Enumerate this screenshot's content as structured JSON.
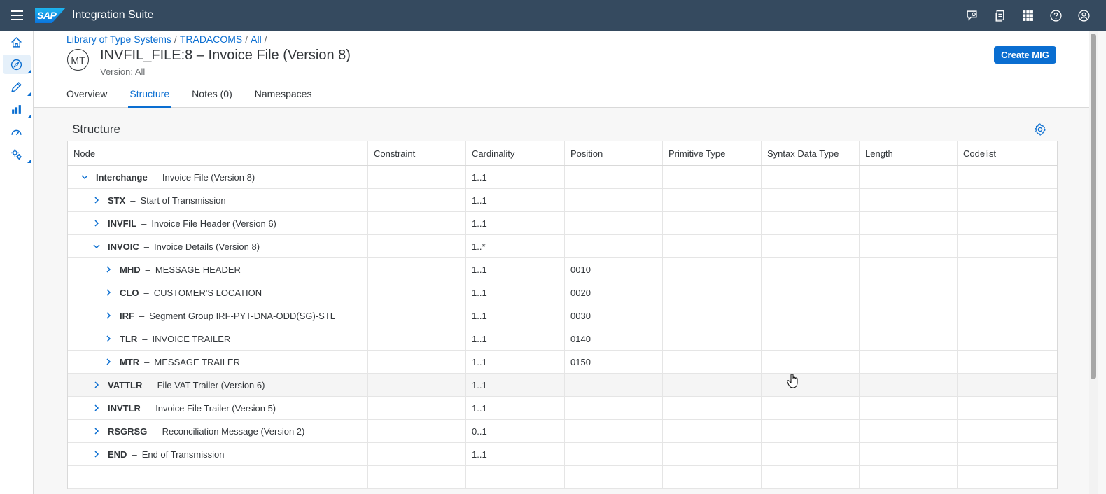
{
  "shell": {
    "product": "Integration Suite",
    "logo_text": "SAP",
    "actions": [
      "feedback-icon",
      "notes-icon",
      "grid-icon",
      "help-icon",
      "user-icon"
    ]
  },
  "sidenav": [
    "home-icon",
    "discover-icon",
    "design-icon",
    "monitor-icon",
    "dashboard-icon",
    "settings-icon"
  ],
  "breadcrumb": [
    "Library of Type Systems",
    "TRADACOMS",
    "All"
  ],
  "header": {
    "avatar": "MT",
    "title": "INVFIL_FILE:8 – Invoice File (Version 8)",
    "subtitle": "Version: All",
    "create_button": "Create MIG"
  },
  "tabs": [
    "Overview",
    "Structure",
    "Notes (0)",
    "Namespaces"
  ],
  "active_tab": "Structure",
  "section": {
    "title": "Structure"
  },
  "columns": [
    "Node",
    "Constraint",
    "Cardinality",
    "Position",
    "Primitive Type",
    "Syntax Data Type",
    "Length",
    "Codelist"
  ],
  "rows": [
    {
      "level": 0,
      "expanded": true,
      "name": "Interchange",
      "desc": "Invoice File (Version 8)",
      "constraint": "",
      "cardinality": "1..1",
      "position": ""
    },
    {
      "level": 1,
      "expanded": false,
      "name": "STX",
      "desc": "Start of Transmission",
      "constraint": "",
      "cardinality": "1..1",
      "position": ""
    },
    {
      "level": 1,
      "expanded": false,
      "name": "INVFIL",
      "desc": "Invoice File Header (Version 6)",
      "constraint": "",
      "cardinality": "1..1",
      "position": ""
    },
    {
      "level": 1,
      "expanded": true,
      "name": "INVOIC",
      "desc": "Invoice Details (Version 8)",
      "constraint": "",
      "cardinality": "1..*",
      "position": ""
    },
    {
      "level": 2,
      "expanded": false,
      "name": "MHD",
      "desc": "MESSAGE HEADER",
      "constraint": "",
      "cardinality": "1..1",
      "position": "0010"
    },
    {
      "level": 2,
      "expanded": false,
      "name": "CLO",
      "desc": "CUSTOMER'S LOCATION",
      "constraint": "",
      "cardinality": "1..1",
      "position": "0020"
    },
    {
      "level": 2,
      "expanded": false,
      "name": "IRF",
      "desc": "Segment Group IRF-PYT-DNA-ODD(SG)-STL",
      "constraint": "",
      "cardinality": "1..1",
      "position": "0030"
    },
    {
      "level": 2,
      "expanded": false,
      "name": "TLR",
      "desc": "INVOICE TRAILER",
      "constraint": "",
      "cardinality": "1..1",
      "position": "0140"
    },
    {
      "level": 2,
      "expanded": false,
      "name": "MTR",
      "desc": "MESSAGE TRAILER",
      "constraint": "",
      "cardinality": "1..1",
      "position": "0150"
    },
    {
      "level": 1,
      "expanded": false,
      "name": "VATTLR",
      "desc": "File VAT Trailer (Version 6)",
      "constraint": "",
      "cardinality": "1..1",
      "position": "",
      "hover": true
    },
    {
      "level": 1,
      "expanded": false,
      "name": "INVTLR",
      "desc": "Invoice File Trailer (Version 5)",
      "constraint": "",
      "cardinality": "1..1",
      "position": ""
    },
    {
      "level": 1,
      "expanded": false,
      "name": "RSGRSG",
      "desc": "Reconciliation Message (Version 2)",
      "constraint": "",
      "cardinality": "0..1",
      "position": ""
    },
    {
      "level": 1,
      "expanded": false,
      "name": "END",
      "desc": "End of Transmission",
      "constraint": "",
      "cardinality": "1..1",
      "position": ""
    },
    {
      "level": -1,
      "name": "",
      "desc": "",
      "constraint": "",
      "cardinality": "",
      "position": ""
    }
  ],
  "colors": {
    "shell": "#354a5f",
    "accent": "#0a6ed1",
    "text": "#32363a"
  }
}
